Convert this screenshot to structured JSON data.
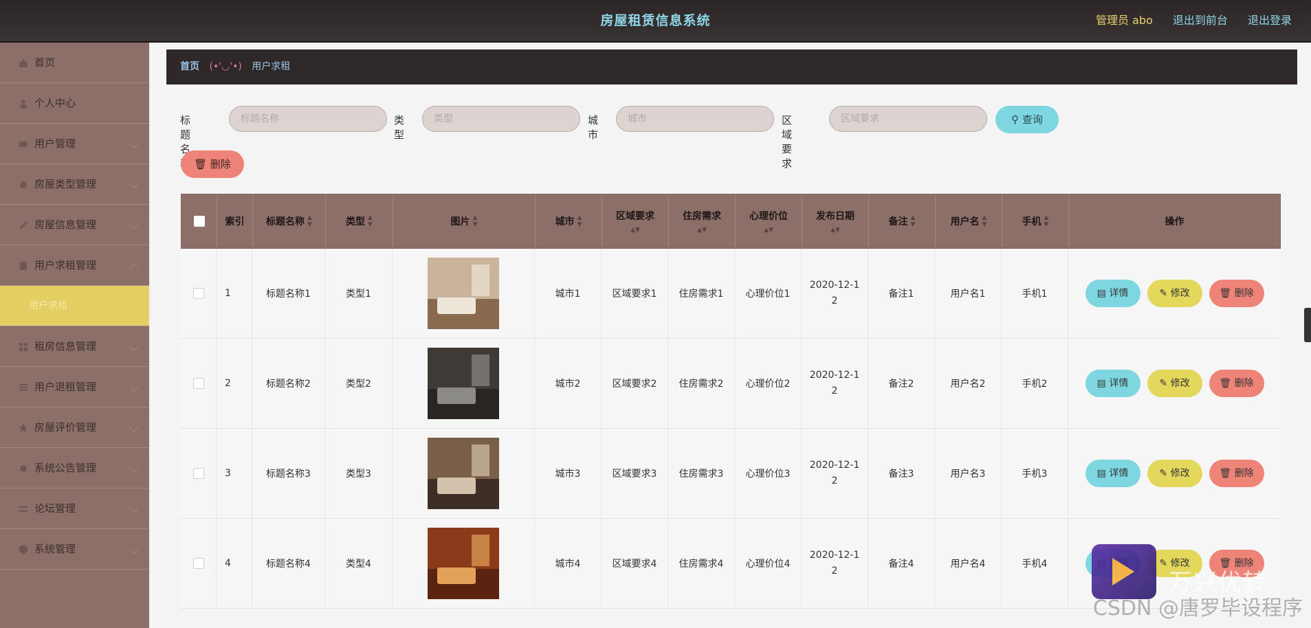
{
  "header": {
    "title": "房屋租赁信息系统",
    "admin": "管理员 abo",
    "to_front": "退出到前台",
    "logout": "退出登录"
  },
  "sidebar": {
    "items": [
      {
        "label": "首页"
      },
      {
        "label": "个人中心"
      },
      {
        "label": "用户管理"
      },
      {
        "label": "房屋类型管理"
      },
      {
        "label": "房屋信息管理"
      },
      {
        "label": "用户求租管理"
      },
      {
        "label": "用户求租"
      },
      {
        "label": "租房信息管理"
      },
      {
        "label": "用户退租管理"
      },
      {
        "label": "房屋评价管理"
      },
      {
        "label": "系统公告管理"
      },
      {
        "label": "论坛管理"
      },
      {
        "label": "系统管理"
      }
    ]
  },
  "breadcrumb": {
    "home": "首页",
    "face": "(•'◡'•)",
    "current": "用户求租"
  },
  "search": {
    "title_label": "标题名称",
    "title_placeholder": "标题名称",
    "type_label": "类型",
    "type_placeholder": "类型",
    "city_label": "城市",
    "city_placeholder": "城市",
    "area_label": "区域要求",
    "area_placeholder": "区域要求",
    "query_button": "查询"
  },
  "actions": {
    "delete_button": "删除"
  },
  "table": {
    "headers": {
      "index": "索引",
      "title": "标题名称",
      "type": "类型",
      "image": "图片",
      "city": "城市",
      "area": "区域要求",
      "need": "住房需求",
      "price": "心理价位",
      "date": "发布日期",
      "note": "备注",
      "username": "用户名",
      "phone": "手机",
      "ops": "操作"
    },
    "rows": [
      {
        "index": "1",
        "title": "标题名称1",
        "type": "类型1",
        "city": "城市1",
        "area": "区域要求1",
        "need": "住房需求1",
        "price": "心理价位1",
        "date": "2020-12-1\n2",
        "note": "备注1",
        "username": "用户名1",
        "phone": "手机1"
      },
      {
        "index": "2",
        "title": "标题名称2",
        "type": "类型2",
        "city": "城市2",
        "area": "区域要求2",
        "need": "住房需求2",
        "price": "心理价位2",
        "date": "2020-12-1\n2",
        "note": "备注2",
        "username": "用户名2",
        "phone": "手机2"
      },
      {
        "index": "3",
        "title": "标题名称3",
        "type": "类型3",
        "city": "城市3",
        "area": "区域要求3",
        "need": "住房需求3",
        "price": "心理价位3",
        "date": "2020-12-1\n2",
        "note": "备注3",
        "username": "用户名3",
        "phone": "手机3"
      },
      {
        "index": "4",
        "title": "标题名称4",
        "type": "类型4",
        "city": "城市4",
        "area": "区域要求4",
        "need": "住房需求4",
        "price": "心理价位4",
        "date": "2020-12-1\n2",
        "note": "备注4",
        "username": "用户名4",
        "phone": "手机4"
      }
    ],
    "op_labels": {
      "detail": "详情",
      "edit": "修改",
      "delete": "删除"
    }
  },
  "watermark": {
    "app": "万兴优转",
    "csdn": "CSDN @唐罗毕设程序"
  },
  "colors": {
    "topbar": "#2c2627",
    "sidebar": "#8c6f69",
    "active": "#e6cf62",
    "query": "#7dd6e0",
    "danger": "#ee8378",
    "edit": "#e3d85c"
  }
}
